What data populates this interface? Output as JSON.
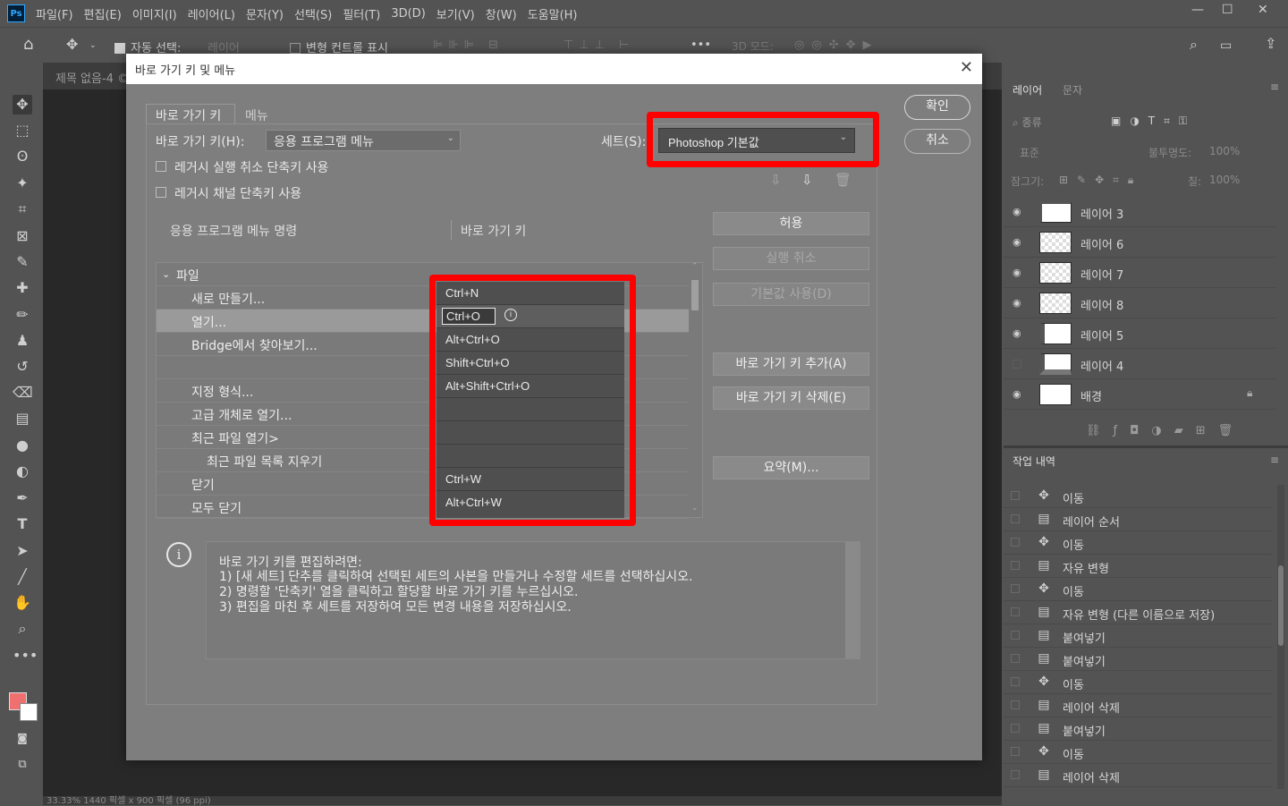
{
  "app": {
    "logo": "Ps"
  },
  "menubar": {
    "items": [
      "파일(F)",
      "편집(E)",
      "이미지(I)",
      "레이어(L)",
      "문자(Y)",
      "선택(S)",
      "필터(T)",
      "3D(D)",
      "보기(V)",
      "창(W)",
      "도움말(H)"
    ],
    "win_min": "—",
    "win_max": "☐",
    "win_close": "✕"
  },
  "optionsbar": {
    "auto_select_label": "자동 선택:",
    "auto_select_value": "레이어",
    "transform_controls_label": "변형 컨트롤 표시",
    "more": "•••",
    "mode3d_label": "3D 모드:"
  },
  "document": {
    "tab_title": "제목 없음-4 ©"
  },
  "layers_panel": {
    "tab_layers": "레이어",
    "tab_text": "문자",
    "filter_placeholder": "종류",
    "blend_mode": "표준",
    "opacity_label": "불투명도:",
    "opacity_value": "100%",
    "lock_label": "잠그기:",
    "fill_label": "칠:",
    "fill_value": "100%",
    "layers": [
      {
        "name": "레이어 3",
        "visible": true,
        "thumb": "frame"
      },
      {
        "name": "레이어 6",
        "visible": true,
        "thumb": "transparent"
      },
      {
        "name": "레이어 7",
        "visible": true,
        "thumb": "transparent"
      },
      {
        "name": "레이어 8",
        "visible": true,
        "thumb": "transparent"
      },
      {
        "name": "레이어 5",
        "visible": true,
        "thumb": "frame"
      },
      {
        "name": "레이어 4",
        "visible": false,
        "thumb": "frame"
      },
      {
        "name": "배경",
        "visible": true,
        "thumb": "white",
        "locked": true
      }
    ]
  },
  "history_panel": {
    "tab": "작업 내역",
    "items": [
      {
        "label": "이동",
        "icon": "move-icon"
      },
      {
        "label": "레이어 순서",
        "icon": "doc-icon"
      },
      {
        "label": "이동",
        "icon": "move-icon"
      },
      {
        "label": "자유 변형",
        "icon": "doc-icon"
      },
      {
        "label": "이동",
        "icon": "move-icon"
      },
      {
        "label": "자유 변형 (다른 이름으로 저장)",
        "icon": "doc-icon"
      },
      {
        "label": "붙여넣기",
        "icon": "doc-icon"
      },
      {
        "label": "붙여넣기",
        "icon": "doc-icon"
      },
      {
        "label": "이동",
        "icon": "move-icon"
      },
      {
        "label": "레이어 삭제",
        "icon": "doc-icon"
      },
      {
        "label": "붙여넣기",
        "icon": "doc-icon"
      },
      {
        "label": "이동",
        "icon": "move-icon"
      },
      {
        "label": "레이어 삭제",
        "icon": "doc-icon"
      }
    ]
  },
  "dialog": {
    "title": "바로 가기 키 및 메뉴",
    "close": "✕",
    "tab_shortcuts": "바로 가기 키",
    "tab_menus": "메뉴",
    "shortcuts_for_label": "바로 가기 키(H):",
    "shortcuts_for_value": "응용 프로그램 메뉴",
    "set_label": "세트(S):",
    "set_value": "Photoshop 기본값",
    "legacy_undo_label": "레거시 실행 취소 단축키 사용",
    "legacy_channel_label": "레거시 채널 단축키 사용",
    "ok_label": "확인",
    "cancel_label": "취소",
    "col_command": "응용 프로그램 메뉴 명령",
    "col_shortcut": "바로 가기 키",
    "group": "파일",
    "rows": [
      {
        "command": "새로 만들기...",
        "shortcut": "Ctrl+N"
      },
      {
        "command": "열기...",
        "shortcut": "Ctrl+O"
      },
      {
        "command": "Bridge에서 찾아보기...",
        "shortcut": "Alt+Ctrl+O"
      },
      {
        "command": "",
        "shortcut": "Shift+Ctrl+O"
      },
      {
        "command": "지정 형식...",
        "shortcut": "Alt+Shift+Ctrl+O"
      },
      {
        "command": "고급 개체로 열기...",
        "shortcut": ""
      },
      {
        "command": "최근 파일 열기>",
        "shortcut": ""
      },
      {
        "command": "최근 파일 목록 지우기",
        "shortcut": ""
      },
      {
        "command": "닫기",
        "shortcut": "Ctrl+W"
      },
      {
        "command": "모두 닫기",
        "shortcut": "Alt+Ctrl+W"
      }
    ],
    "accept_label": "허용",
    "undo_label": "실행 취소",
    "use_default_label": "기본값 사용(D)",
    "add_shortcut_label": "바로 가기 키 추가(A)",
    "delete_shortcut_label": "바로 가기 키 삭제(E)",
    "summary_label": "요약(M)...",
    "info": [
      "바로 가기 키를 편집하려면:",
      "1) [새 세트] 단추를 클릭하여 선택된 세트의 사본을 만들거나 수정할 세트를 선택하십시오.",
      "2) 명령할 '단축키' 열을 클릭하고 할당할 바로 가기 키를 누르십시오.",
      "3) 편집을 마친 후 세트를 저장하여 모든 변경 내용을 저장하십시오."
    ]
  },
  "status": {
    "text": "33.33%   1440 픽셀 x 900 픽셀 (96 ppi)"
  },
  "colors": {
    "highlight": "#ff0000",
    "ps_blue": "#31a8ff",
    "foreground": "#f07070",
    "background": "#ffffff"
  }
}
